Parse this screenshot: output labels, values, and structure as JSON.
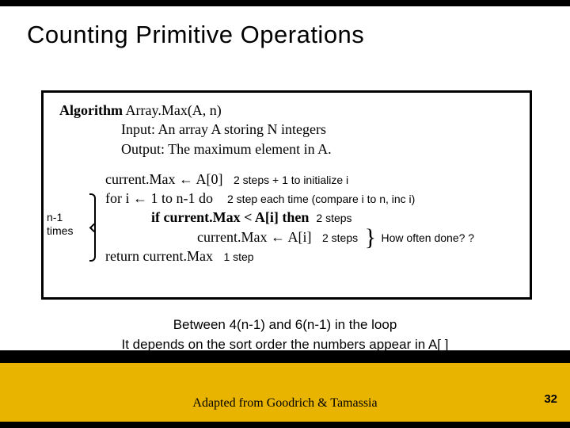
{
  "title": "Counting Primitive Operations",
  "algo": {
    "kw": "Algorithm",
    "sig": "Array.Max(A, n)",
    "input": "Input: An array A storing N integers",
    "output": "Output: The maximum element in A."
  },
  "side_label": {
    "l1": "n-1",
    "l2": "times"
  },
  "code": {
    "l1a": "current.Max",
    "l1b": "A[0]",
    "l1ann": "2 steps + 1 to initialize i",
    "l2a": "for i",
    "l2b": "1 to n-1 do",
    "l2ann": "2 step each time (compare i to n, inc i)",
    "l3a": "if current.Max < A[i] then",
    "l3ann": "2 steps",
    "l4a": "current.Max",
    "l4b": "A[i]",
    "l4ann": "2 steps",
    "l4q": "How often done? ?",
    "l5a": "return current.Max",
    "l5ann": "1 step",
    "arrow": "←"
  },
  "summary": {
    "s1": "Between 4(n-1) and 6(n-1) in the loop",
    "s2": "It depends on the sort order the numbers appear in A[ ]"
  },
  "footer": "Adapted from Goodrich & Tamassia",
  "slide_number": "32"
}
